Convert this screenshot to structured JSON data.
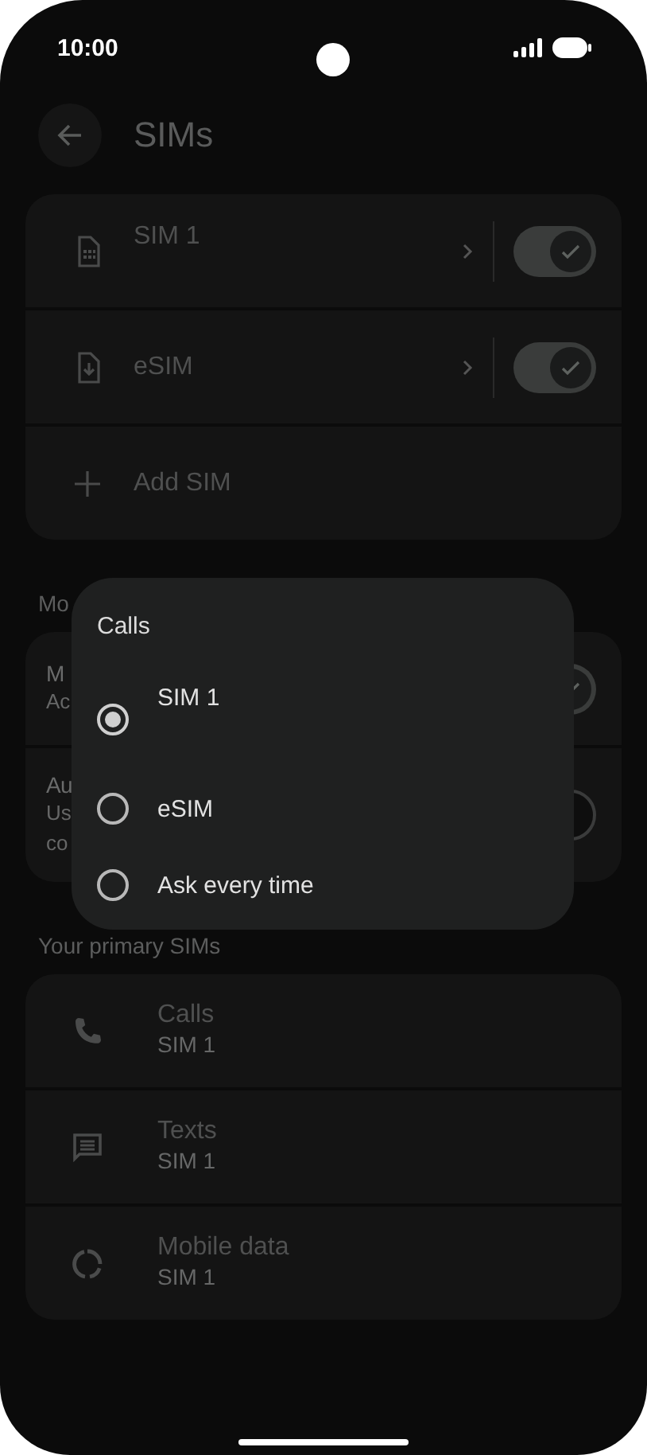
{
  "status_bar": {
    "time": "10:00"
  },
  "header": {
    "title": "SIMs"
  },
  "sims": [
    {
      "kind": "sim",
      "name": "SIM 1",
      "on": true
    },
    {
      "kind": "esim",
      "name": "eSIM",
      "on": true
    },
    {
      "kind": "add",
      "name": "Add SIM"
    }
  ],
  "mobile_section": {
    "title": "Mo",
    "rows": [
      {
        "title": "M",
        "subtitle_lines": [
          "Ac"
        ],
        "on": true
      },
      {
        "title": "Au",
        "subtitle_lines": [
          "Us",
          "co"
        ],
        "on": false
      }
    ]
  },
  "primary_section": {
    "title": "Your primary SIMs",
    "rows": [
      {
        "kind": "calls",
        "title": "Calls",
        "subtitle": "SIM 1"
      },
      {
        "kind": "texts",
        "title": "Texts",
        "subtitle": "SIM 1"
      },
      {
        "kind": "data",
        "title": "Mobile data",
        "subtitle": "SIM 1"
      }
    ]
  },
  "dialog": {
    "title": "Calls",
    "options": [
      {
        "label": "SIM 1",
        "selected": true
      },
      {
        "label": "eSIM",
        "selected": false
      },
      {
        "label": "Ask every time",
        "selected": false
      }
    ]
  }
}
